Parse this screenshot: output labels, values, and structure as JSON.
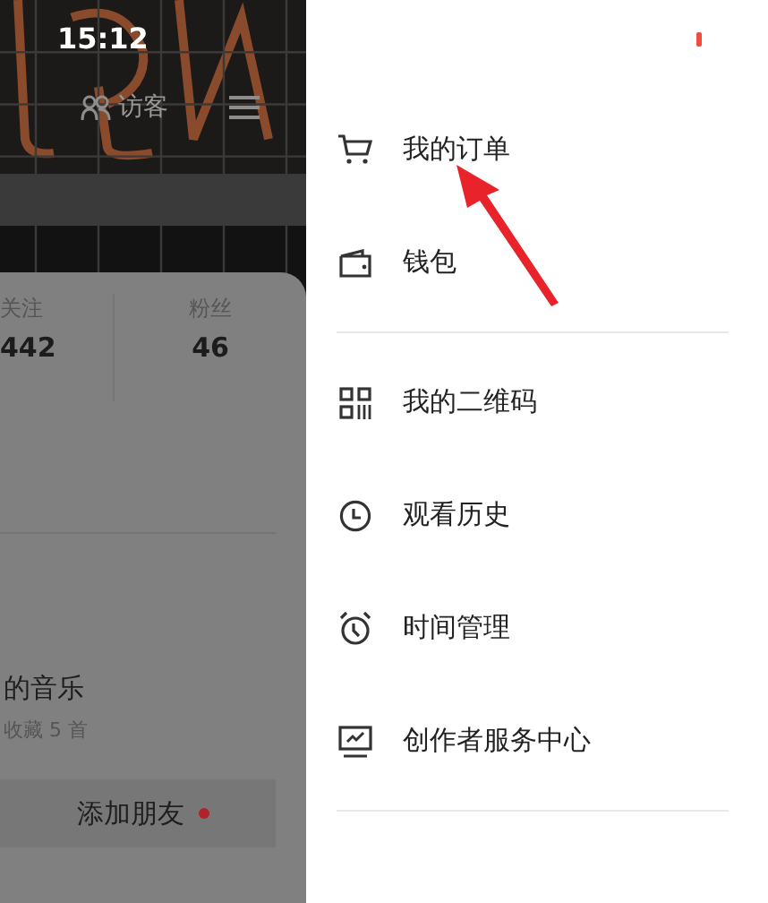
{
  "status_bar": {
    "time": "15:12"
  },
  "profile_header": {
    "visitor_label": "访客"
  },
  "stats": [
    {
      "label": "关注",
      "value": "442"
    },
    {
      "label": "粉丝",
      "value": "46"
    }
  ],
  "music": {
    "title": "的音乐",
    "subtitle": "收藏 5 首"
  },
  "add_friend_button": {
    "label": "添加朋友",
    "has_notification": true
  },
  "drawer": {
    "has_notification": true,
    "sections": [
      {
        "items": [
          {
            "kind": "cart",
            "label": "我的订单"
          },
          {
            "kind": "wallet",
            "label": "钱包"
          }
        ]
      },
      {
        "items": [
          {
            "kind": "qr",
            "label": "我的二维码"
          },
          {
            "kind": "clock",
            "label": "观看历史"
          },
          {
            "kind": "alarm",
            "label": "时间管理"
          },
          {
            "kind": "monitor",
            "label": "创作者服务中心"
          }
        ]
      }
    ]
  },
  "annotation": {
    "kind": "arrow"
  }
}
